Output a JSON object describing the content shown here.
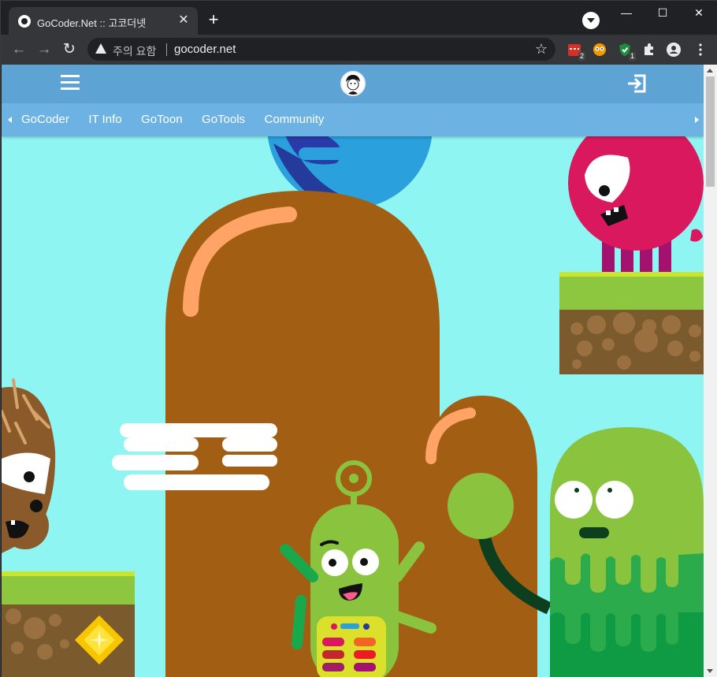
{
  "browser": {
    "tab": {
      "title": "GoCoder.Net :: 고코더넷",
      "close": "✕"
    },
    "new_tab": "+",
    "window": {
      "minimize": "—",
      "maximize": "☐",
      "close": "✕"
    },
    "omnibox": {
      "security_text": "주의 요함",
      "url": "gocoder.net"
    },
    "extensions": [
      {
        "name": "calendar-extension",
        "badge": "2",
        "color": "#d93025"
      },
      {
        "name": "face-extension",
        "badge": "",
        "color": "#f29900"
      },
      {
        "name": "shield-extension",
        "badge": "1",
        "color": "#1e8e3e"
      }
    ]
  },
  "site": {
    "nav": [
      "GoCoder",
      "IT Info",
      "GoToon",
      "GoTools",
      "Community"
    ],
    "colors": {
      "header": "#5da4d4",
      "nav": "#6cb3e3",
      "sky": "#8ff5f3",
      "hill": "#a25f14",
      "arc": "#ffa466",
      "pink_monster": "#d9185d",
      "green_monster": "#8ac43f",
      "grass": "#8dc63f",
      "dirt": "#7b5a2e"
    }
  }
}
